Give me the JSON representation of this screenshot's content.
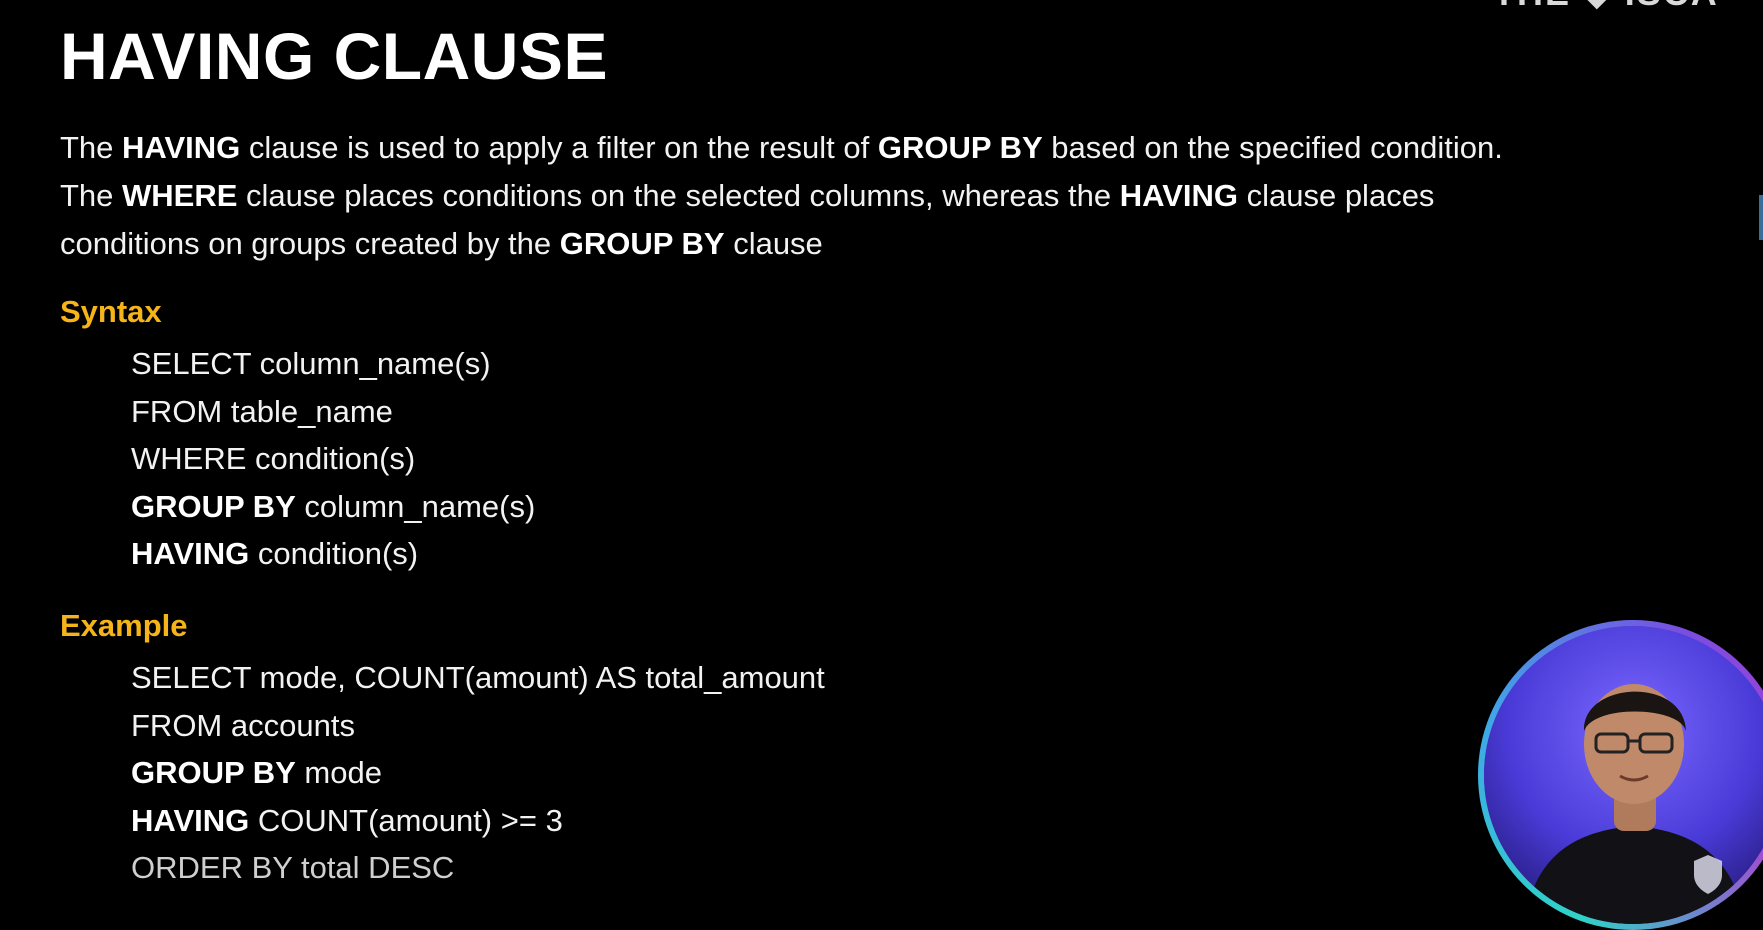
{
  "title": "HAVING CLAUSE",
  "intro": {
    "line1": {
      "p1": "The ",
      "k1": "HAVING",
      "p2": " clause is used to apply a filter on the result of ",
      "k2": "GROUP BY",
      "p3": " based on the specified condition."
    },
    "line2": {
      "p1": "The ",
      "k1": "WHERE",
      "p2": " clause places conditions on the selected columns, whereas the ",
      "k2": "HAVING",
      "p3": " clause places"
    },
    "line3": {
      "p1": "conditions on groups created by the ",
      "k1": "GROUP BY",
      "p2": " clause"
    }
  },
  "syntax": {
    "label": "Syntax",
    "lines": [
      {
        "kw": "",
        "rest": "SELECT column_name(s)"
      },
      {
        "kw": "",
        "rest": "FROM table_name"
      },
      {
        "kw": "",
        "rest": "WHERE condition(s)"
      },
      {
        "kw": "GROUP BY",
        "rest": " column_name(s)"
      },
      {
        "kw": "HAVING",
        "rest": " condition(s)"
      }
    ]
  },
  "example": {
    "label": "Example",
    "lines": [
      {
        "kw": "",
        "rest": "SELECT mode, COUNT(amount) AS total_amount"
      },
      {
        "kw": "",
        "rest": "FROM accounts"
      },
      {
        "kw": "GROUP BY",
        "rest": " mode"
      },
      {
        "kw": "HAVING",
        "rest": " COUNT(amount) >= 3"
      },
      {
        "kw": "",
        "rest": "ORDER BY total DESC"
      }
    ]
  },
  "logo": {
    "text": "THE ◆ ISCA"
  },
  "colors": {
    "background": "#000000",
    "heading_accent": "#f4b41a",
    "text": "#f2f2f2"
  }
}
